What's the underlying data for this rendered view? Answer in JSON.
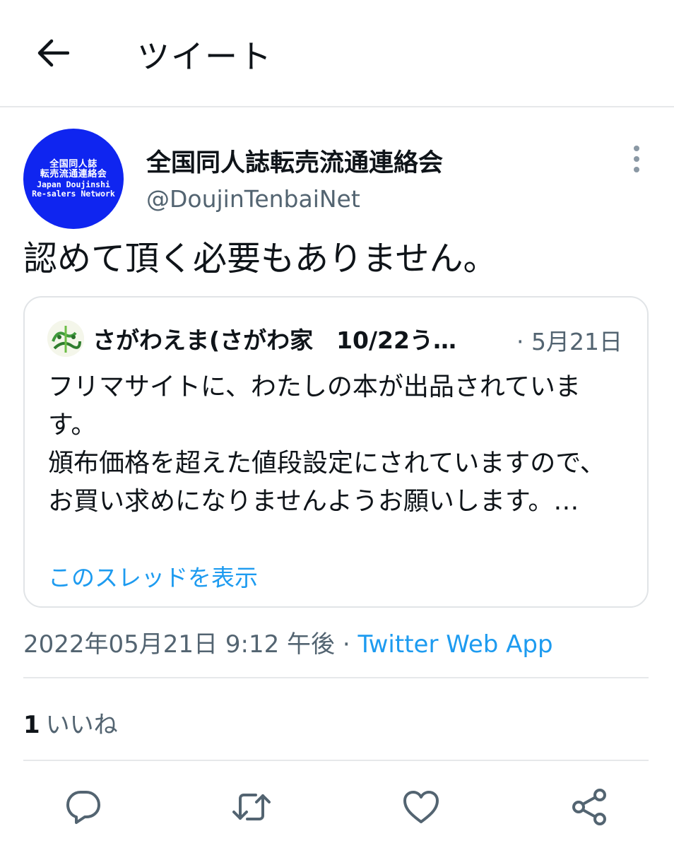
{
  "header": {
    "title": "ツイート",
    "back_icon": "arrow-left-icon"
  },
  "tweet": {
    "author": {
      "display_name": "全国同人誌転売流通連絡会",
      "handle": "@DoujinTenbaiNet",
      "avatar": {
        "line1": "全国同人誌",
        "line2": "転売流通連絡会",
        "line3": "Japan Doujinshi",
        "line4": "Re-salers Network",
        "bg_color": "#0f25f0"
      }
    },
    "text": "認めて頂く必要もありません。",
    "quote": {
      "author_name": "さがわえま(さがわ家　10/22う…",
      "date": "· 5月21日",
      "body": "フリマサイトに、わたしの本が出品されています。\n頒布価格を超えた値段設定にされていますので、お買い求めになりませんようお願いします。…",
      "thread_link": "このスレッドを表示"
    },
    "timestamp": "2022年05月21日 9:12 午後",
    "separator": " · ",
    "source_app": "Twitter Web App",
    "likes": {
      "count": "1",
      "label": "いいね"
    }
  },
  "actions": {
    "reply_icon": "comment-icon",
    "retweet_icon": "retweet-icon",
    "like_icon": "heart-icon",
    "share_icon": "share-icon"
  },
  "colors": {
    "link": "#1d9bf0",
    "secondary_text": "#536471",
    "primary_text": "#0f1419",
    "border": "#e6e8ea"
  }
}
